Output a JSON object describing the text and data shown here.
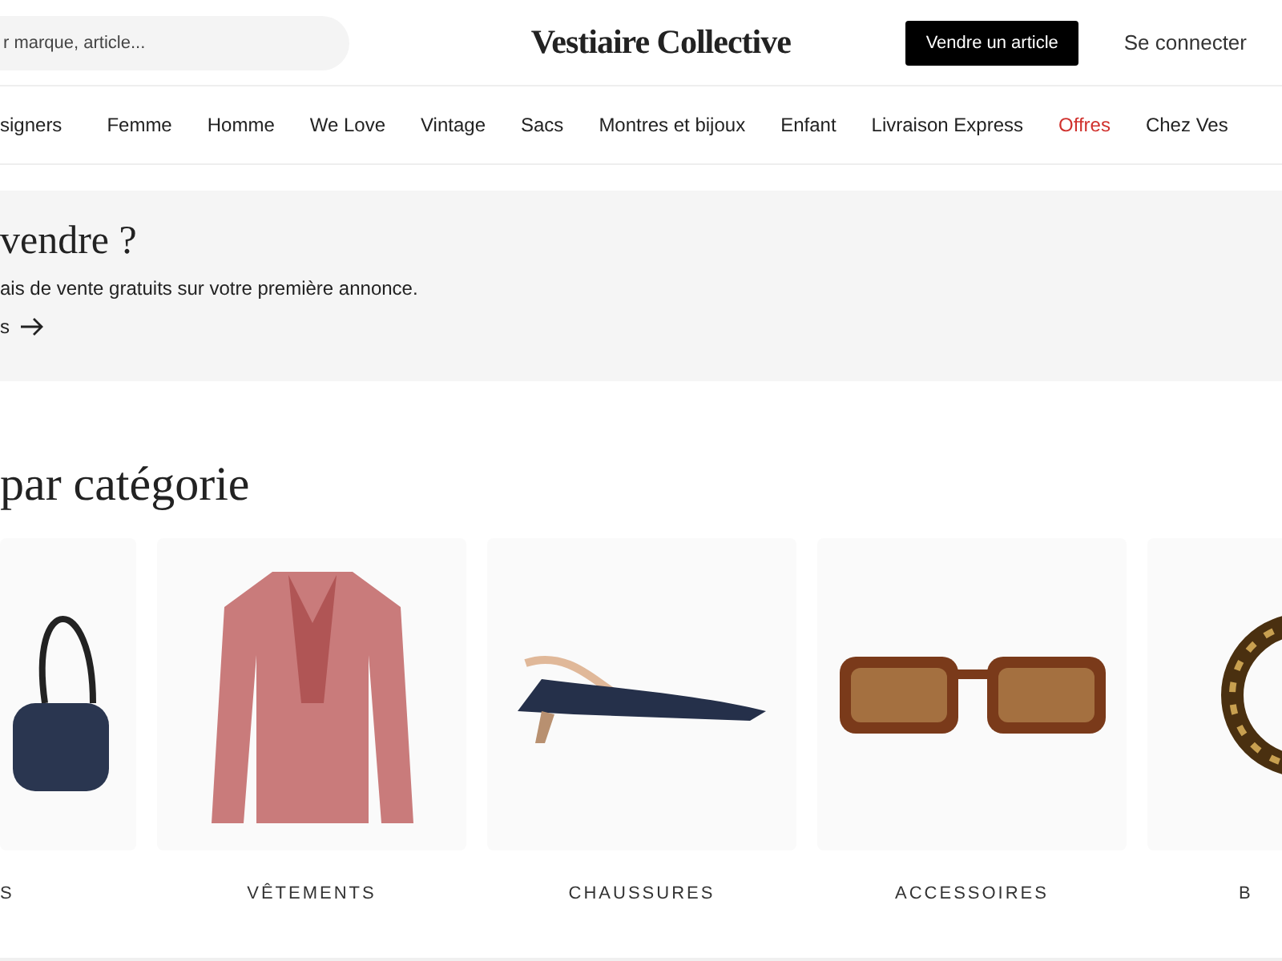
{
  "header": {
    "search": {
      "placeholder": "r marque, article..."
    },
    "logo": "Vestiaire Collective",
    "sell_button": "Vendre un article",
    "login_link": "Se connecter"
  },
  "nav": [
    {
      "label": "signers",
      "kind": "normal"
    },
    {
      "label": "Femme",
      "kind": "normal"
    },
    {
      "label": "Homme",
      "kind": "normal"
    },
    {
      "label": "We Love",
      "kind": "normal"
    },
    {
      "label": "Vintage",
      "kind": "normal"
    },
    {
      "label": "Sacs",
      "kind": "normal"
    },
    {
      "label": "Montres et bijoux",
      "kind": "normal"
    },
    {
      "label": "Enfant",
      "kind": "normal"
    },
    {
      "label": "Livraison Express",
      "kind": "normal"
    },
    {
      "label": "Offres",
      "kind": "promo"
    },
    {
      "label": "Chez Ves",
      "kind": "normal"
    }
  ],
  "banner": {
    "title": "vendre ?",
    "text": "ais de vente gratuits sur votre première annonce.",
    "link": "s"
  },
  "categories": {
    "heading": "par catégorie",
    "items": [
      {
        "label": "S",
        "kind": "bag"
      },
      {
        "label": "VÊTEMENTS",
        "kind": "shirt"
      },
      {
        "label": "CHAUSSURES",
        "kind": "shoe"
      },
      {
        "label": "ACCESSOIRES",
        "kind": "sunglasses"
      },
      {
        "label": "B",
        "kind": "bracelet"
      }
    ]
  }
}
